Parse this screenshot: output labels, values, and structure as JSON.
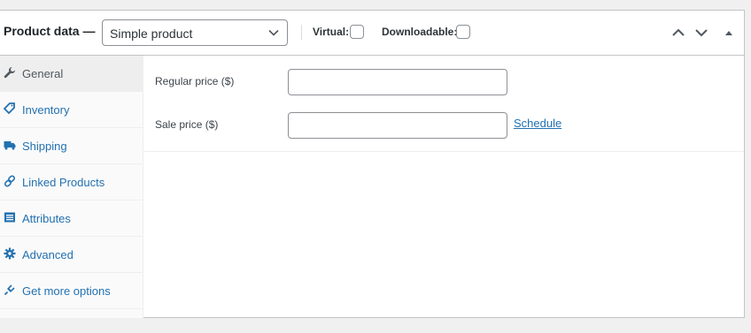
{
  "header": {
    "title": "Product data —",
    "product_type": {
      "selected": "Simple product"
    },
    "virtual_label": "Virtual:",
    "downloadable_label": "Downloadable:",
    "buttons": [
      "move-up-icon",
      "move-down-icon",
      "toggle-panel-icon"
    ]
  },
  "tabs": [
    {
      "label": "General",
      "icon": "wrench-icon",
      "active": true
    },
    {
      "label": "Inventory",
      "icon": "tag-icon",
      "active": false
    },
    {
      "label": "Shipping",
      "icon": "truck-icon",
      "active": false
    },
    {
      "label": "Linked Products",
      "icon": "link-icon",
      "active": false
    },
    {
      "label": "Attributes",
      "icon": "list-icon",
      "active": false
    },
    {
      "label": "Advanced",
      "icon": "gear-icon",
      "active": false
    },
    {
      "label": "Get more options",
      "icon": "plugin-icon",
      "active": false
    }
  ],
  "general": {
    "regular_price_label": "Regular price ($)",
    "regular_price_value": "",
    "sale_price_label": "Sale price ($)",
    "sale_price_value": "",
    "schedule_link": "Schedule"
  },
  "colors": {
    "link": "#2271b1",
    "border": "#c3c4c7",
    "background": "#f0f0f1"
  }
}
